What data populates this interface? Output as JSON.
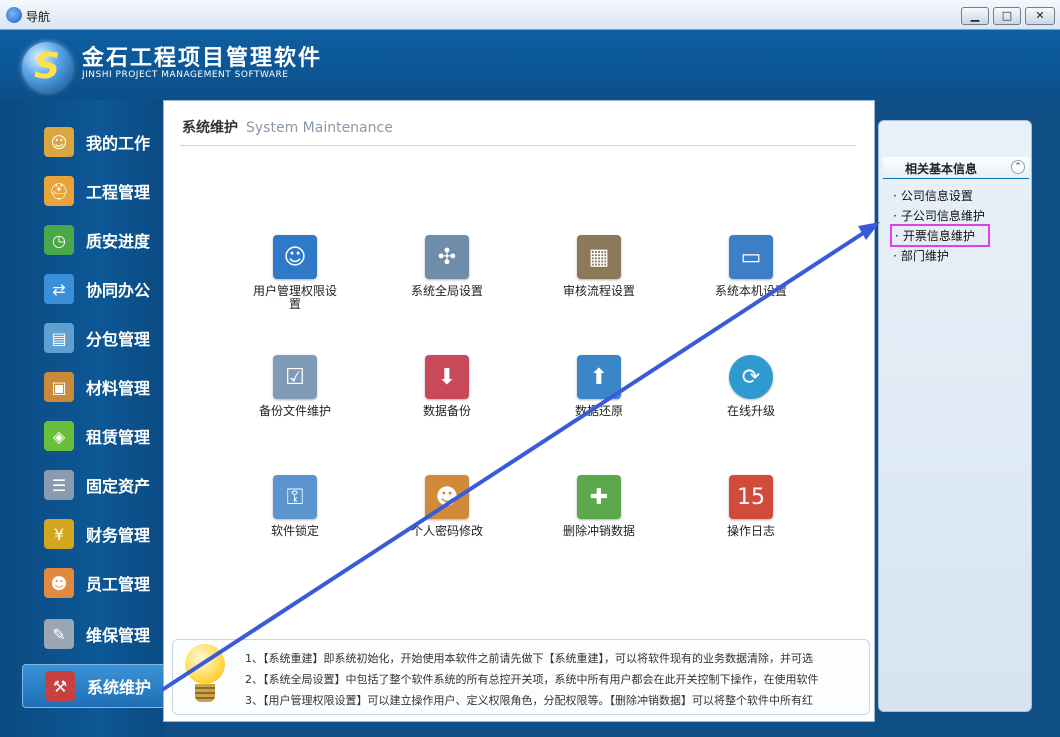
{
  "window": {
    "title": "导航"
  },
  "brand": {
    "title": "金石工程项目管理软件",
    "subtitle": "JINSHI PROJECT MANAGEMENT SOFTWARE"
  },
  "sidebar": {
    "items": [
      {
        "label": "我的工作",
        "icon": "my-work-icon",
        "active": false
      },
      {
        "label": "工程管理",
        "icon": "worker-icon",
        "active": false
      },
      {
        "label": "质安进度",
        "icon": "clock-progress-icon",
        "active": false
      },
      {
        "label": "协同办公",
        "icon": "collaboration-icon",
        "active": false
      },
      {
        "label": "分包管理",
        "icon": "subcontract-icon",
        "active": false
      },
      {
        "label": "材料管理",
        "icon": "box-icon",
        "active": false
      },
      {
        "label": "租赁管理",
        "icon": "cubes-icon",
        "active": false
      },
      {
        "label": "固定资产",
        "icon": "server-rack-icon",
        "active": false
      },
      {
        "label": "财务管理",
        "icon": "money-icon",
        "active": false
      },
      {
        "label": "员工管理",
        "icon": "users-icon",
        "active": false
      },
      {
        "label": "维保管理",
        "icon": "wrench-icon",
        "active": false
      },
      {
        "label": "系统维护",
        "icon": "toolbox-icon",
        "active": true
      }
    ]
  },
  "main": {
    "title": "系统维护",
    "title_en": "System Maintenance",
    "tiles": [
      {
        "label": "用户管理权限设置",
        "icon": "user-permission-icon"
      },
      {
        "label": "系统全局设置",
        "icon": "global-settings-icon"
      },
      {
        "label": "审核流程设置",
        "icon": "approval-flow-icon"
      },
      {
        "label": "系统本机设置",
        "icon": "local-settings-icon"
      },
      {
        "label": "备份文件维护",
        "icon": "backup-files-icon"
      },
      {
        "label": "数据备份",
        "icon": "data-backup-icon"
      },
      {
        "label": "数据还原",
        "icon": "data-restore-icon"
      },
      {
        "label": "在线升级",
        "icon": "online-upgrade-icon"
      },
      {
        "label": "软件锁定",
        "icon": "lock-icon"
      },
      {
        "label": "个人密码修改",
        "icon": "password-change-icon"
      },
      {
        "label": "删除冲销数据",
        "icon": "delete-data-icon"
      },
      {
        "label": "操作日志",
        "icon": "calendar-log-icon"
      }
    ],
    "tips": [
      "1、【系统重建】即系统初始化，开始使用本软件之前请先做下【系统重建】，可以将软件现有的业务数据清除，并可选",
      "2、【系统全局设置】中包括了整个软件系统的所有总控开关项，系统中所有用户都会在此开关控制下操作，在使用软件",
      "3、【用户管理权限设置】可以建立操作用户、定义权限角色，分配权限等。【删除冲销数据】可以将整个软件中所有红"
    ]
  },
  "related": {
    "title": "相关基本信息",
    "links": [
      {
        "label": "公司信息设置",
        "highlight": false
      },
      {
        "label": "子公司信息维护",
        "highlight": false
      },
      {
        "label": "开票信息维护",
        "highlight": true
      },
      {
        "label": "部门维护",
        "highlight": false
      }
    ]
  },
  "colors": {
    "accent": "#0e5fa3",
    "highlight_box": "#e040e8",
    "arrow": "#3a5bd9"
  }
}
